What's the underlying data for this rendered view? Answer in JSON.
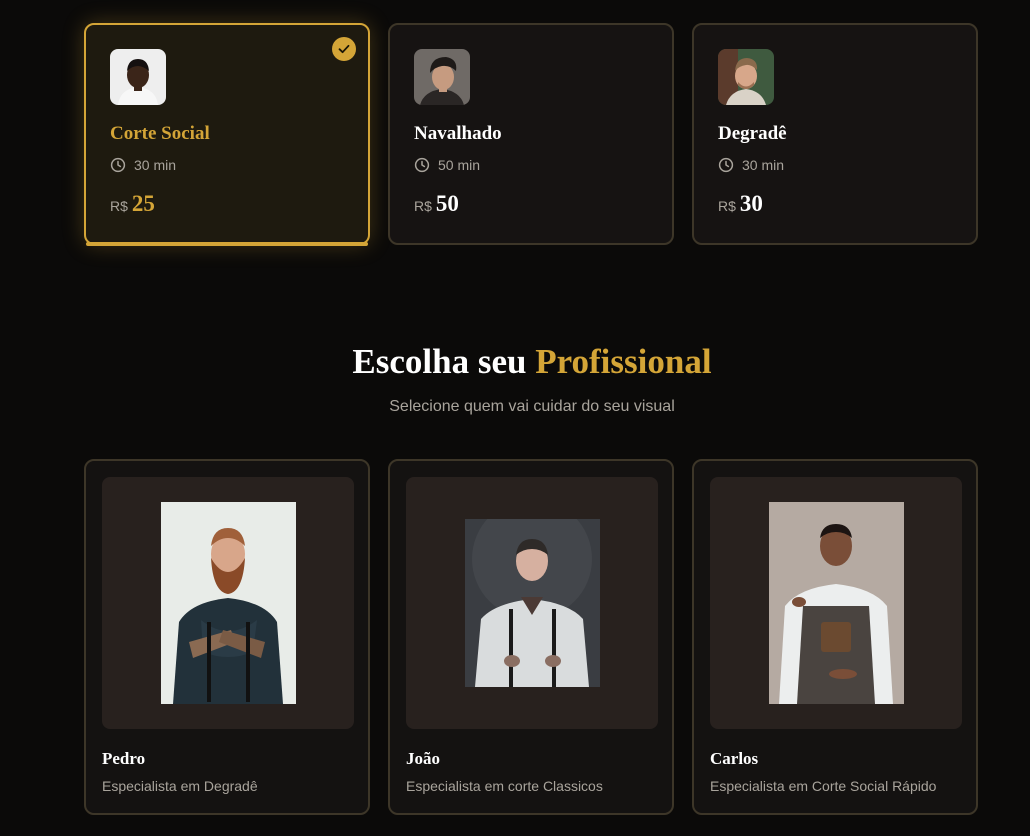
{
  "services": [
    {
      "title": "Corte Social",
      "duration": "30 min",
      "currency": "R$",
      "price": "25",
      "selected": true,
      "icon": "check-icon"
    },
    {
      "title": "Navalhado",
      "duration": "50 min",
      "currency": "R$",
      "price": "50",
      "selected": false
    },
    {
      "title": "Degradê",
      "duration": "30 min",
      "currency": "R$",
      "price": "30",
      "selected": false
    }
  ],
  "professionals_section": {
    "title_prefix": "Escolha seu ",
    "title_accent": "Profissional",
    "subtitle": "Selecione quem vai cuidar do seu visual"
  },
  "professionals": [
    {
      "name": "Pedro",
      "specialty": "Especialista em Degradê"
    },
    {
      "name": "João",
      "specialty": "Especialista em corte Classicos"
    },
    {
      "name": "Carlos",
      "specialty": "Especialista em Corte Social Rápido"
    }
  ],
  "colors": {
    "background": "#0b0a09",
    "accent": "#d4a537",
    "card_border": "#3d3628",
    "muted_text": "#a9a49c"
  }
}
